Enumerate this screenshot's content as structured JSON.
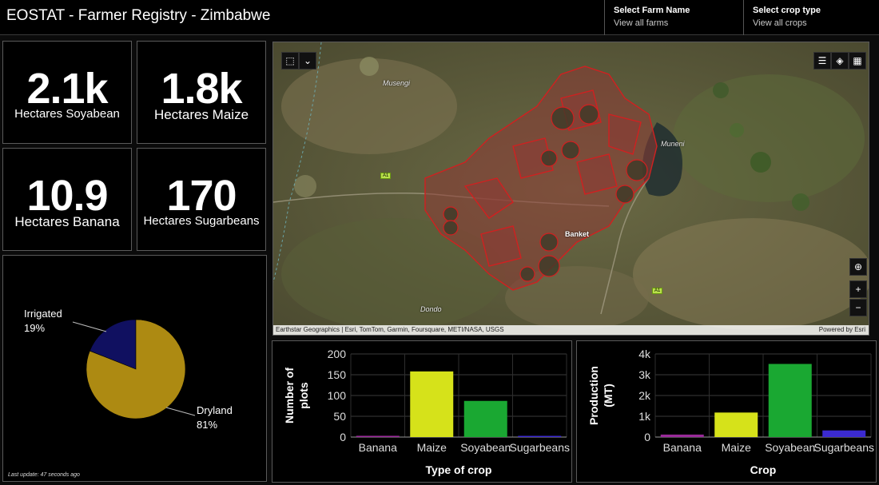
{
  "header": {
    "title": "EOSTAT - Farmer Registry - Zimbabwe",
    "farm_selector": {
      "label": "Select Farm Name",
      "value": "View all farms"
    },
    "crop_selector": {
      "label": "Select crop type",
      "value": "View all crops"
    }
  },
  "kpis": [
    {
      "value": "2.1k",
      "caption": "Hectares Soyabean"
    },
    {
      "value": "1.8k",
      "caption": "Hectares Maize"
    },
    {
      "value": "10.9",
      "caption": "Hectares Banana"
    },
    {
      "value": "170",
      "caption": "Hectares Sugarbeans"
    }
  ],
  "irrigation_pie": {
    "type": "pie",
    "slices": [
      {
        "name": "Irrigated",
        "value": 19,
        "label": "19%",
        "color": "#101060"
      },
      {
        "name": "Dryland",
        "value": 81,
        "label": "81%",
        "color": "#ad8a12"
      }
    ],
    "last_update": "Last update: 47 seconds ago"
  },
  "map": {
    "attribution": "Earthstar Geographics | Esri, TomTom, Garmin, Foursquare, METI/NASA, USGS",
    "powered_by": "Powered by Esri",
    "places": [
      "Musengi",
      "Muneni",
      "Banket",
      "Dondo"
    ],
    "road_label": "A1",
    "zoom_in": "+",
    "zoom_out": "−"
  },
  "chart_data": [
    {
      "type": "bar",
      "categories": [
        "Banana",
        "Maize",
        "Soyabean",
        "Sugarbeans"
      ],
      "values": [
        3,
        158,
        87,
        2
      ],
      "colors": [
        "#9a2a9a",
        "#d6e21a",
        "#1aa832",
        "#3b2ad0"
      ],
      "xlabel": "Type of crop",
      "ylabel": "Number of plots",
      "ylim": [
        0,
        200
      ],
      "yticks": [
        0,
        50,
        100,
        150,
        200
      ],
      "ytick_labels": [
        "0",
        "50",
        "100",
        "150",
        "200"
      ]
    },
    {
      "type": "bar",
      "categories": [
        "Banana",
        "Maize",
        "Soyabean",
        "Sugarbeans"
      ],
      "values": [
        120,
        1180,
        3520,
        320
      ],
      "colors": [
        "#9a2a9a",
        "#d6e21a",
        "#1aa832",
        "#3b2ad0"
      ],
      "xlabel": "Crop",
      "ylabel": "Production (MT)",
      "ylim": [
        0,
        4000
      ],
      "yticks": [
        0,
        1000,
        2000,
        3000,
        4000
      ],
      "ytick_labels": [
        "0",
        "1k",
        "2k",
        "3k",
        "4k"
      ]
    }
  ]
}
